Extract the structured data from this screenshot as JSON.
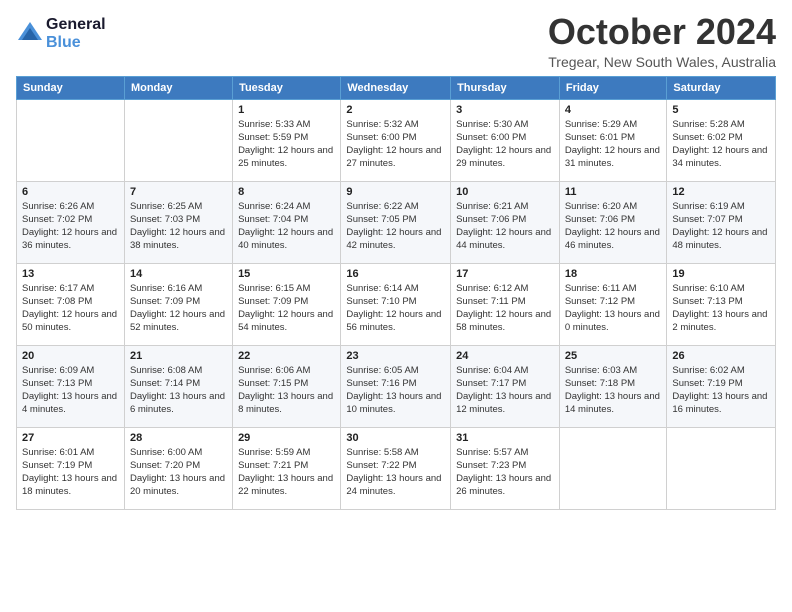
{
  "logo": {
    "line1": "General",
    "line2": "Blue"
  },
  "title": "October 2024",
  "location": "Tregear, New South Wales, Australia",
  "days_of_week": [
    "Sunday",
    "Monday",
    "Tuesday",
    "Wednesday",
    "Thursday",
    "Friday",
    "Saturday"
  ],
  "weeks": [
    [
      {
        "day": "",
        "sunrise": "",
        "sunset": "",
        "daylight": ""
      },
      {
        "day": "",
        "sunrise": "",
        "sunset": "",
        "daylight": ""
      },
      {
        "day": "1",
        "sunrise": "Sunrise: 5:33 AM",
        "sunset": "Sunset: 5:59 PM",
        "daylight": "Daylight: 12 hours and 25 minutes."
      },
      {
        "day": "2",
        "sunrise": "Sunrise: 5:32 AM",
        "sunset": "Sunset: 6:00 PM",
        "daylight": "Daylight: 12 hours and 27 minutes."
      },
      {
        "day": "3",
        "sunrise": "Sunrise: 5:30 AM",
        "sunset": "Sunset: 6:00 PM",
        "daylight": "Daylight: 12 hours and 29 minutes."
      },
      {
        "day": "4",
        "sunrise": "Sunrise: 5:29 AM",
        "sunset": "Sunset: 6:01 PM",
        "daylight": "Daylight: 12 hours and 31 minutes."
      },
      {
        "day": "5",
        "sunrise": "Sunrise: 5:28 AM",
        "sunset": "Sunset: 6:02 PM",
        "daylight": "Daylight: 12 hours and 34 minutes."
      }
    ],
    [
      {
        "day": "6",
        "sunrise": "Sunrise: 6:26 AM",
        "sunset": "Sunset: 7:02 PM",
        "daylight": "Daylight: 12 hours and 36 minutes."
      },
      {
        "day": "7",
        "sunrise": "Sunrise: 6:25 AM",
        "sunset": "Sunset: 7:03 PM",
        "daylight": "Daylight: 12 hours and 38 minutes."
      },
      {
        "day": "8",
        "sunrise": "Sunrise: 6:24 AM",
        "sunset": "Sunset: 7:04 PM",
        "daylight": "Daylight: 12 hours and 40 minutes."
      },
      {
        "day": "9",
        "sunrise": "Sunrise: 6:22 AM",
        "sunset": "Sunset: 7:05 PM",
        "daylight": "Daylight: 12 hours and 42 minutes."
      },
      {
        "day": "10",
        "sunrise": "Sunrise: 6:21 AM",
        "sunset": "Sunset: 7:06 PM",
        "daylight": "Daylight: 12 hours and 44 minutes."
      },
      {
        "day": "11",
        "sunrise": "Sunrise: 6:20 AM",
        "sunset": "Sunset: 7:06 PM",
        "daylight": "Daylight: 12 hours and 46 minutes."
      },
      {
        "day": "12",
        "sunrise": "Sunrise: 6:19 AM",
        "sunset": "Sunset: 7:07 PM",
        "daylight": "Daylight: 12 hours and 48 minutes."
      }
    ],
    [
      {
        "day": "13",
        "sunrise": "Sunrise: 6:17 AM",
        "sunset": "Sunset: 7:08 PM",
        "daylight": "Daylight: 12 hours and 50 minutes."
      },
      {
        "day": "14",
        "sunrise": "Sunrise: 6:16 AM",
        "sunset": "Sunset: 7:09 PM",
        "daylight": "Daylight: 12 hours and 52 minutes."
      },
      {
        "day": "15",
        "sunrise": "Sunrise: 6:15 AM",
        "sunset": "Sunset: 7:09 PM",
        "daylight": "Daylight: 12 hours and 54 minutes."
      },
      {
        "day": "16",
        "sunrise": "Sunrise: 6:14 AM",
        "sunset": "Sunset: 7:10 PM",
        "daylight": "Daylight: 12 hours and 56 minutes."
      },
      {
        "day": "17",
        "sunrise": "Sunrise: 6:12 AM",
        "sunset": "Sunset: 7:11 PM",
        "daylight": "Daylight: 12 hours and 58 minutes."
      },
      {
        "day": "18",
        "sunrise": "Sunrise: 6:11 AM",
        "sunset": "Sunset: 7:12 PM",
        "daylight": "Daylight: 13 hours and 0 minutes."
      },
      {
        "day": "19",
        "sunrise": "Sunrise: 6:10 AM",
        "sunset": "Sunset: 7:13 PM",
        "daylight": "Daylight: 13 hours and 2 minutes."
      }
    ],
    [
      {
        "day": "20",
        "sunrise": "Sunrise: 6:09 AM",
        "sunset": "Sunset: 7:13 PM",
        "daylight": "Daylight: 13 hours and 4 minutes."
      },
      {
        "day": "21",
        "sunrise": "Sunrise: 6:08 AM",
        "sunset": "Sunset: 7:14 PM",
        "daylight": "Daylight: 13 hours and 6 minutes."
      },
      {
        "day": "22",
        "sunrise": "Sunrise: 6:06 AM",
        "sunset": "Sunset: 7:15 PM",
        "daylight": "Daylight: 13 hours and 8 minutes."
      },
      {
        "day": "23",
        "sunrise": "Sunrise: 6:05 AM",
        "sunset": "Sunset: 7:16 PM",
        "daylight": "Daylight: 13 hours and 10 minutes."
      },
      {
        "day": "24",
        "sunrise": "Sunrise: 6:04 AM",
        "sunset": "Sunset: 7:17 PM",
        "daylight": "Daylight: 13 hours and 12 minutes."
      },
      {
        "day": "25",
        "sunrise": "Sunrise: 6:03 AM",
        "sunset": "Sunset: 7:18 PM",
        "daylight": "Daylight: 13 hours and 14 minutes."
      },
      {
        "day": "26",
        "sunrise": "Sunrise: 6:02 AM",
        "sunset": "Sunset: 7:19 PM",
        "daylight": "Daylight: 13 hours and 16 minutes."
      }
    ],
    [
      {
        "day": "27",
        "sunrise": "Sunrise: 6:01 AM",
        "sunset": "Sunset: 7:19 PM",
        "daylight": "Daylight: 13 hours and 18 minutes."
      },
      {
        "day": "28",
        "sunrise": "Sunrise: 6:00 AM",
        "sunset": "Sunset: 7:20 PM",
        "daylight": "Daylight: 13 hours and 20 minutes."
      },
      {
        "day": "29",
        "sunrise": "Sunrise: 5:59 AM",
        "sunset": "Sunset: 7:21 PM",
        "daylight": "Daylight: 13 hours and 22 minutes."
      },
      {
        "day": "30",
        "sunrise": "Sunrise: 5:58 AM",
        "sunset": "Sunset: 7:22 PM",
        "daylight": "Daylight: 13 hours and 24 minutes."
      },
      {
        "day": "31",
        "sunrise": "Sunrise: 5:57 AM",
        "sunset": "Sunset: 7:23 PM",
        "daylight": "Daylight: 13 hours and 26 minutes."
      },
      {
        "day": "",
        "sunrise": "",
        "sunset": "",
        "daylight": ""
      },
      {
        "day": "",
        "sunrise": "",
        "sunset": "",
        "daylight": ""
      }
    ]
  ]
}
